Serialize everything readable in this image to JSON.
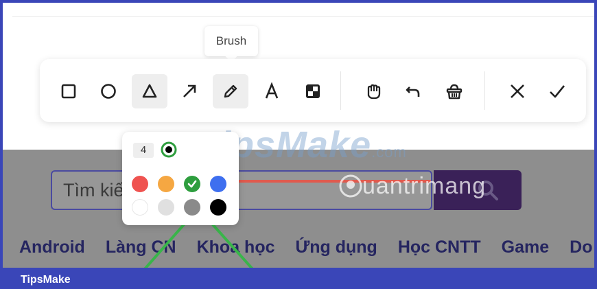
{
  "tooltip": {
    "text": "Brush"
  },
  "toolbar": {
    "tools": [
      {
        "name": "rectangle",
        "icon": "square-icon",
        "active": false
      },
      {
        "name": "ellipse",
        "icon": "circle-icon",
        "active": false
      },
      {
        "name": "triangle",
        "icon": "triangle-icon",
        "active": true
      },
      {
        "name": "arrow",
        "icon": "arrow-icon",
        "active": false
      },
      {
        "name": "brush",
        "icon": "pencil-icon",
        "active": true
      },
      {
        "name": "text",
        "icon": "text-icon",
        "active": false
      },
      {
        "name": "mosaic",
        "icon": "mosaic-icon",
        "active": false
      },
      {
        "name": "pan",
        "icon": "hand-icon",
        "active": false
      },
      {
        "name": "undo",
        "icon": "undo-icon",
        "active": false
      },
      {
        "name": "clear",
        "icon": "trash-icon",
        "active": false
      },
      {
        "name": "cancel",
        "icon": "close-icon",
        "active": false
      },
      {
        "name": "confirm",
        "icon": "check-icon",
        "active": false
      }
    ]
  },
  "palette": {
    "size": "4",
    "selected_color": "#2e9e3e",
    "colors": [
      "#ef5350",
      "#f5a742",
      "#2e9e3e",
      "#3e6fef",
      "#ffffff",
      "#e0e0e0",
      "#8a8a8a",
      "#000000"
    ]
  },
  "page": {
    "search_placeholder": "Tìm kiế",
    "nav_items": [
      "Android",
      "Làng CN",
      "Khoa học",
      "Ứng dụng",
      "Học CNTT",
      "Game",
      "Do"
    ],
    "watermark_main": "TipsMake",
    "watermark_sub": ".com",
    "watermark_second": "uantrimang"
  },
  "footer": {
    "brand": "TipsMake"
  },
  "colors": {
    "frame": "#3a46b8",
    "overlay": "#8e8e8e",
    "search_button": "#3a2158",
    "annotation_green": "#39b54a",
    "annotation_red": "#e05a4e"
  }
}
